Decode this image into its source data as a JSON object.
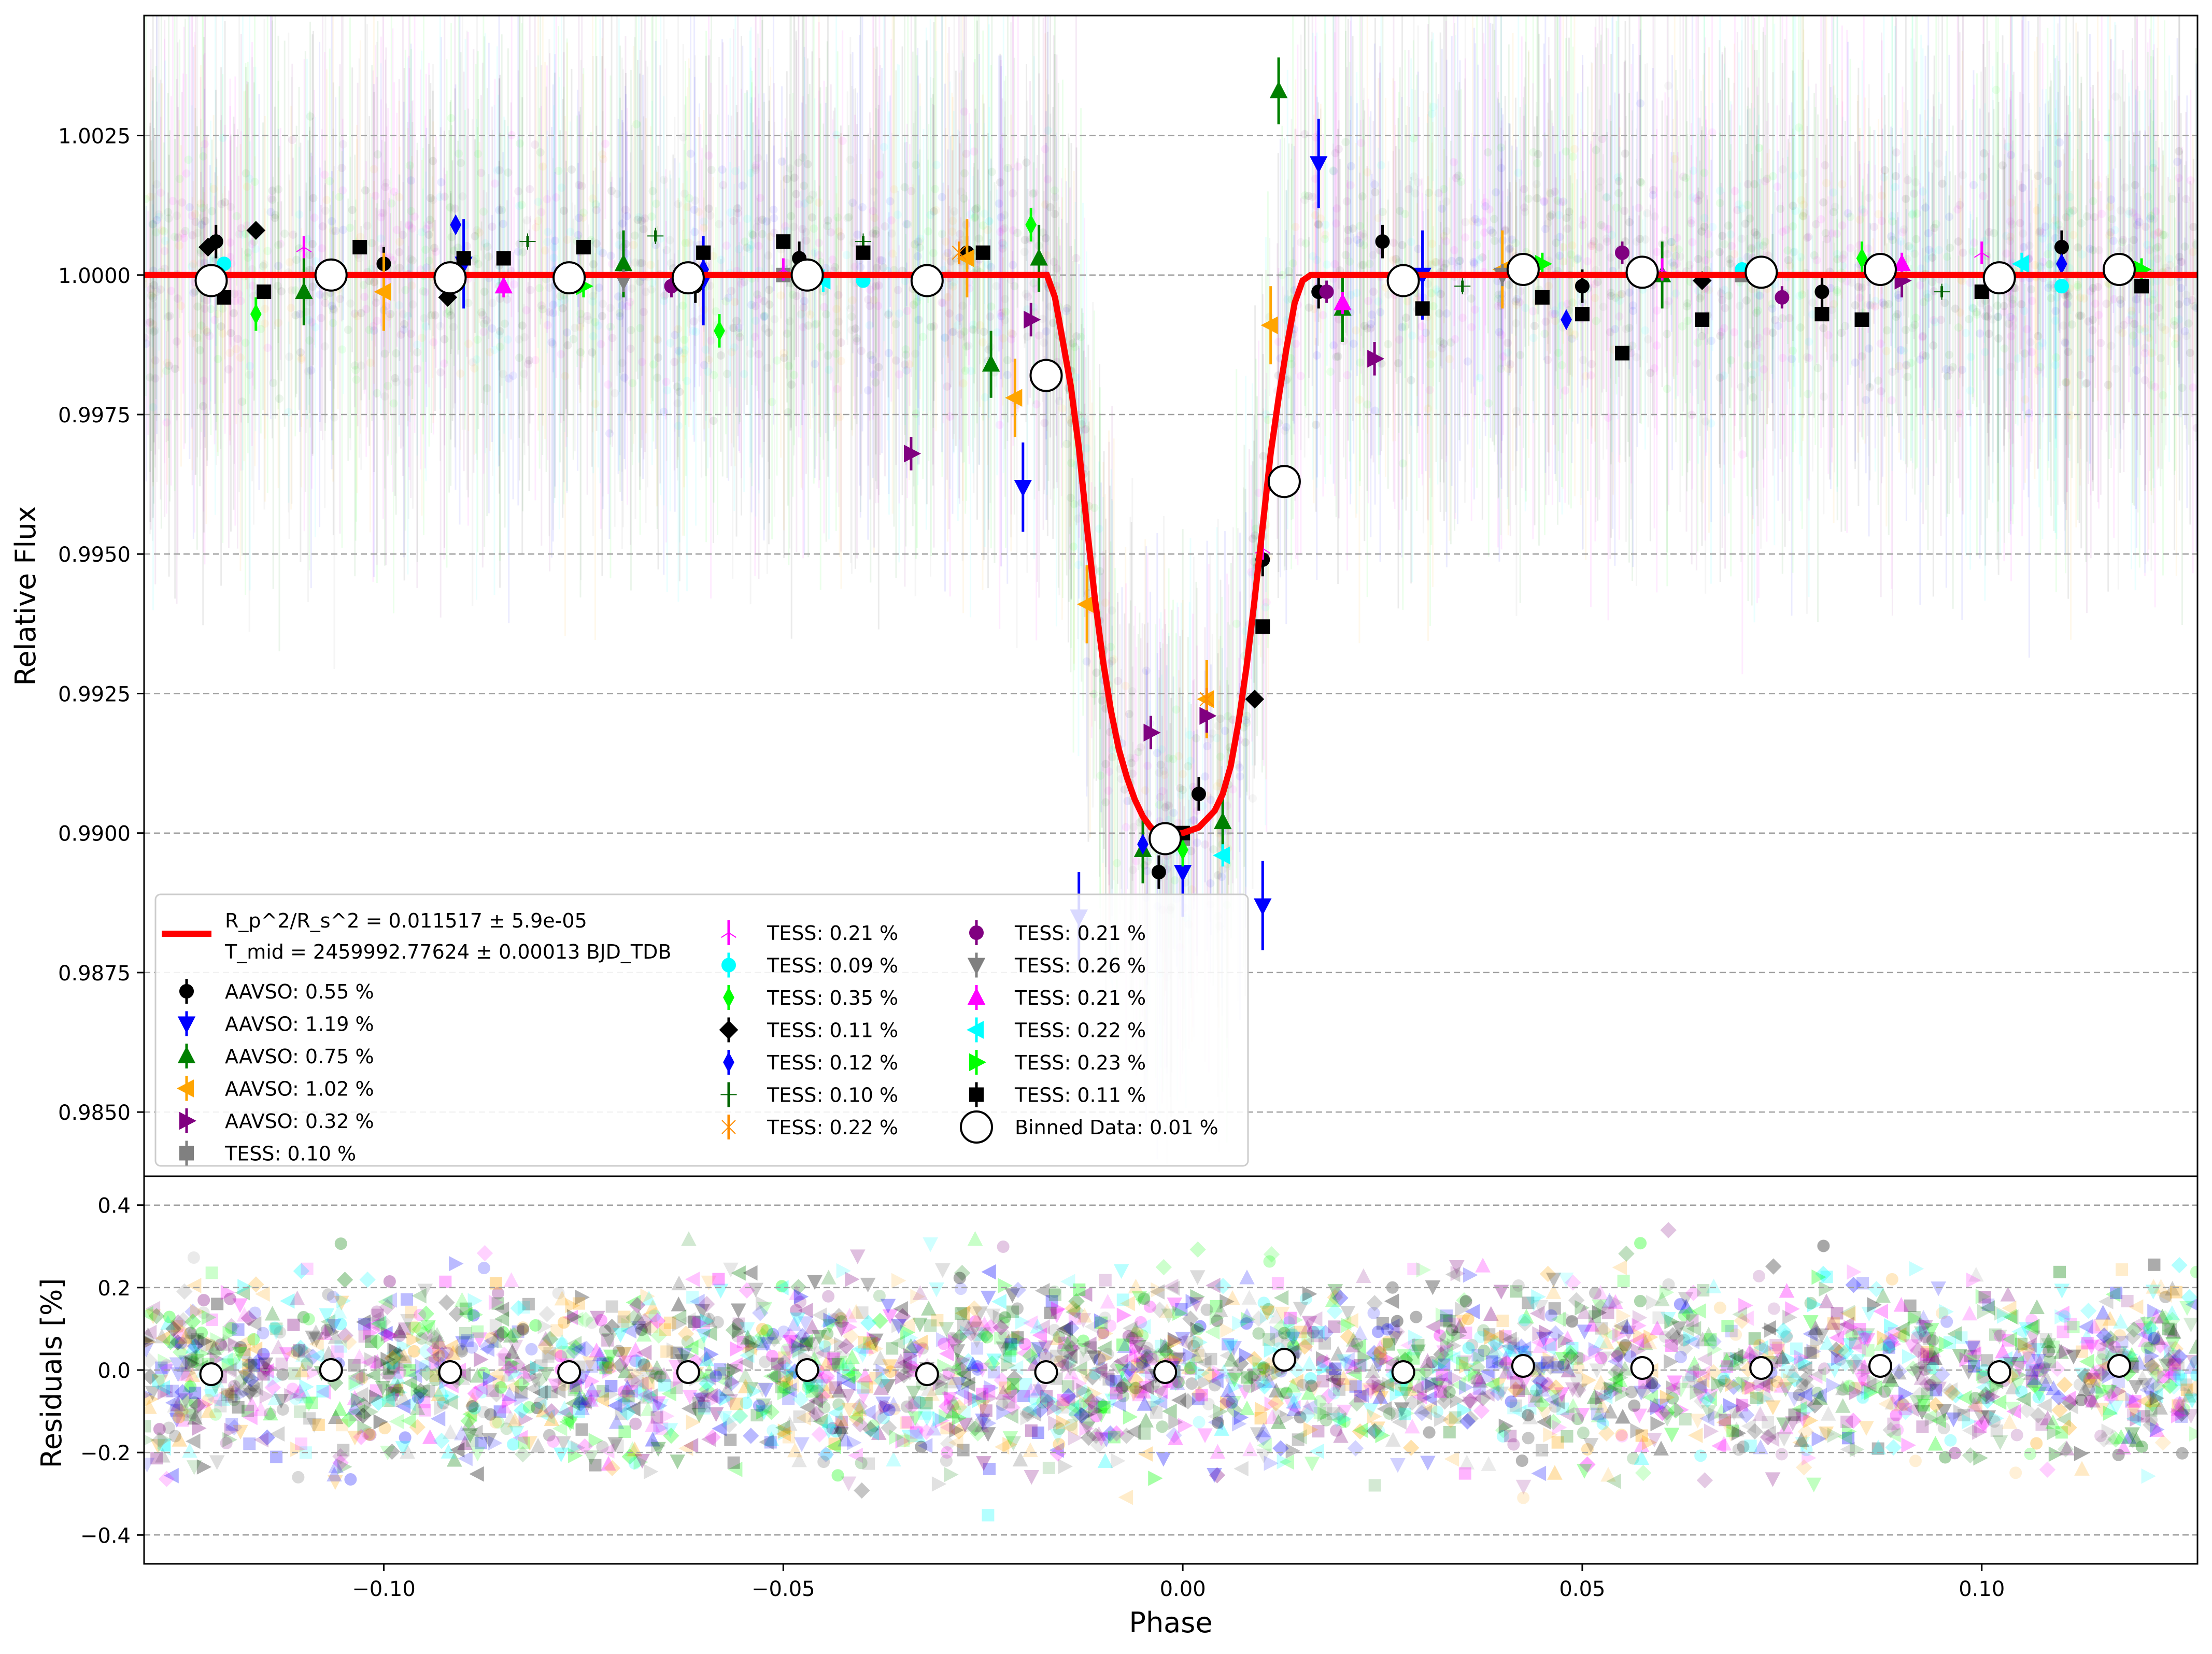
{
  "chart_data": [
    {
      "type": "scatter",
      "panel": "transit",
      "ylabel": "Relative Flux",
      "xlim": [
        -0.13,
        0.127
      ],
      "ylim": [
        0.98385,
        1.00465
      ],
      "yticks": [
        0.985,
        0.9875,
        0.99,
        0.9925,
        0.995,
        0.9975,
        1.0,
        1.0025
      ],
      "ytick_labels": [
        "0.9850",
        "0.9875",
        "0.9900",
        "0.9925",
        "0.9950",
        "0.9975",
        "1.0000",
        "1.0025"
      ],
      "grid": "horizontal dashed",
      "legend_position": "lower-left",
      "model": {
        "name": "R_p^2/R_s^2 = 0.011517 ± 5.9e-05",
        "name_line2": "T_mid = 2459992.77624 ± 0.00013 BJD_TDB",
        "color": "#ff0000",
        "x": [
          -0.13,
          -0.02,
          -0.017,
          -0.016,
          -0.014,
          -0.013,
          -0.012,
          -0.011,
          -0.01,
          -0.009,
          -0.008,
          -0.007,
          -0.006,
          -0.005,
          -0.004,
          -0.003,
          -0.002,
          -0.001,
          0.0,
          0.002,
          0.004,
          0.005,
          0.006,
          0.007,
          0.008,
          0.009,
          0.01,
          0.011,
          0.012,
          0.013,
          0.014,
          0.015,
          0.016,
          0.017,
          0.02,
          0.127
        ],
        "y": [
          1.0,
          1.0,
          1.0,
          0.9996,
          0.998,
          0.9969,
          0.9955,
          0.9942,
          0.9931,
          0.9922,
          0.9915,
          0.991,
          0.9906,
          0.9903,
          0.9901,
          0.99,
          0.99,
          0.99,
          0.99,
          0.9901,
          0.9904,
          0.9907,
          0.9912,
          0.992,
          0.993,
          0.9942,
          0.9955,
          0.9968,
          0.9978,
          0.9987,
          0.9995,
          0.9999,
          1.0,
          1.0,
          1.0,
          1.0
        ]
      },
      "binned": {
        "name": "Binned Data: 0.01 %",
        "x": [
          -0.1216,
          -0.1066,
          -0.0917,
          -0.0768,
          -0.0619,
          -0.047,
          -0.032,
          -0.0171,
          -0.0022,
          0.0127,
          0.0276,
          0.0426,
          0.0575,
          0.0724,
          0.0873,
          0.1022,
          0.1172
        ],
        "y": [
          0.9999,
          1.0,
          0.99995,
          0.99995,
          0.99995,
          1.0,
          0.9999,
          0.9982,
          0.9899,
          0.9963,
          0.9999,
          1.0001,
          1.00005,
          1.00005,
          1.0001,
          0.99995,
          1.0001
        ]
      },
      "series": [
        {
          "name": "AAVSO: 0.55 %",
          "color": "#000000",
          "marker": "circle",
          "x": [
            -0.121,
            -0.1,
            -0.061,
            -0.048,
            -0.027,
            -0.003,
            0.002,
            0.01,
            0.017,
            0.025,
            0.05,
            0.08,
            0.11
          ],
          "y": [
            1.0006,
            1.0002,
            0.9998,
            1.0003,
            1.0004,
            0.9893,
            0.9907,
            0.9949,
            0.9997,
            1.0006,
            0.9998,
            0.9997,
            1.0005
          ],
          "err": 0.0003
        },
        {
          "name": "AAVSO: 1.19 %",
          "color": "#0000ff",
          "marker": "triangle-down",
          "x": [
            -0.09,
            -0.06,
            -0.02,
            -0.013,
            0.0,
            0.01,
            0.017,
            0.03
          ],
          "y": [
            1.0002,
            0.9999,
            0.9962,
            0.9885,
            0.9893,
            0.9887,
            1.002,
            1.0
          ],
          "err": 0.0008
        },
        {
          "name": "AAVSO: 0.75 %",
          "color": "#008000",
          "marker": "triangle-up",
          "x": [
            -0.11,
            -0.07,
            -0.024,
            -0.018,
            -0.005,
            0.005,
            0.012,
            0.02,
            0.06
          ],
          "y": [
            0.9997,
            1.0002,
            0.9984,
            1.0003,
            0.9897,
            0.9902,
            1.0033,
            0.9994,
            1.0
          ],
          "err": 0.0006
        },
        {
          "name": "AAVSO: 1.02 %",
          "color": "#ffa500",
          "marker": "triangle-left",
          "x": [
            -0.1,
            -0.027,
            -0.021,
            -0.012,
            0.003,
            0.011,
            0.04
          ],
          "y": [
            0.9997,
            1.0003,
            0.9978,
            0.9941,
            0.9924,
            0.9991,
            1.0001
          ],
          "err": 0.0007
        },
        {
          "name": "AAVSO: 0.32 %",
          "color": "#800080",
          "marker": "triangle-right",
          "x": [
            -0.034,
            -0.019,
            -0.004,
            0.003,
            0.024,
            0.09
          ],
          "y": [
            0.9968,
            0.9992,
            0.9918,
            0.9921,
            0.9985,
            0.9999
          ],
          "err": 0.0003
        },
        {
          "name": "TESS: 0.10 %",
          "color": "#808080",
          "marker": "square",
          "x": [
            -0.05,
            0.0,
            0.07
          ],
          "y": [
            1.0,
            0.9899,
            1.0
          ],
          "err": 0.0001
        },
        {
          "name": "TESS: 0.21 %",
          "color": "#ff00ff",
          "marker": "tri",
          "x": [
            -0.11,
            -0.05,
            0.01,
            0.06,
            0.1
          ],
          "y": [
            1.0005,
            1.0001,
            0.9951,
            1.0001,
            1.0004
          ],
          "err": 0.0002
        },
        {
          "name": "TESS: 0.09 %",
          "color": "#00ffff",
          "marker": "circle",
          "x": [
            -0.12,
            -0.04,
            0.07,
            0.11
          ],
          "y": [
            1.0002,
            0.9999,
            1.0001,
            0.9998
          ],
          "err": 0.0001
        },
        {
          "name": "TESS: 0.35 %",
          "color": "#00ff00",
          "marker": "diamond-thin",
          "x": [
            -0.116,
            -0.058,
            -0.019,
            0.0,
            0.085
          ],
          "y": [
            0.9993,
            0.999,
            1.0009,
            0.9897,
            1.0003
          ],
          "err": 0.0003
        },
        {
          "name": "TESS: 0.11 %",
          "color": "#000000",
          "marker": "diamond",
          "x": [
            -0.122,
            -0.116,
            -0.092,
            0.009,
            0.065
          ],
          "y": [
            1.0005,
            1.0008,
            0.9996,
            0.9924,
            0.9999
          ],
          "err": 0.0001
        },
        {
          "name": "TESS: 0.12 %",
          "color": "#0000ff",
          "marker": "diamond-thin",
          "x": [
            -0.091,
            -0.06,
            -0.005,
            0.048,
            0.11
          ],
          "y": [
            1.0009,
            1.0001,
            0.9898,
            0.9992,
            1.0002
          ],
          "err": 0.0001
        },
        {
          "name": "TESS: 0.10 %",
          "color": "#006400",
          "marker": "plus",
          "x": [
            -0.082,
            -0.066,
            -0.04,
            0.035,
            0.095
          ],
          "y": [
            1.0006,
            1.0007,
            1.0006,
            0.9998,
            0.9997
          ],
          "err": 0.0001
        },
        {
          "name": "TESS: 0.22 %",
          "color": "#ff8c00",
          "marker": "x",
          "x": [
            -0.028,
            0.003
          ],
          "y": [
            1.0004,
            0.9924
          ],
          "err": 0.0002
        },
        {
          "name": "TESS: 0.21 %",
          "color": "#800080",
          "marker": "circle",
          "x": [
            -0.064,
            0.018,
            0.055,
            0.075
          ],
          "y": [
            0.9998,
            0.9997,
            1.0004,
            0.9996
          ],
          "err": 0.0002
        },
        {
          "name": "TESS: 0.26 %",
          "color": "#808080",
          "marker": "triangle-down",
          "x": [
            -0.07,
            0.04
          ],
          "y": [
            0.9999,
            1.0
          ],
          "err": 0.0002
        },
        {
          "name": "TESS: 0.21 %",
          "color": "#ff00ff",
          "marker": "triangle-up",
          "x": [
            -0.085,
            0.02,
            0.09
          ],
          "y": [
            0.9998,
            0.9995,
            1.0002
          ],
          "err": 0.0002
        },
        {
          "name": "TESS: 0.22 %",
          "color": "#00ffff",
          "marker": "triangle-left",
          "x": [
            -0.045,
            0.005,
            0.105
          ],
          "y": [
            0.9999,
            0.9896,
            1.0002
          ],
          "err": 0.0002
        },
        {
          "name": "TESS: 0.23 %",
          "color": "#00ff00",
          "marker": "triangle-right",
          "x": [
            -0.075,
            0.045,
            0.12
          ],
          "y": [
            0.9998,
            1.0002,
            1.0001
          ],
          "err": 0.0002
        },
        {
          "name": "TESS: 0.11 %",
          "color": "#000000",
          "marker": "square",
          "x": [
            -0.12,
            -0.115,
            -0.103,
            -0.09,
            -0.085,
            -0.075,
            -0.06,
            -0.05,
            -0.04,
            -0.025,
            0.0,
            0.01,
            0.03,
            0.045,
            0.05,
            0.055,
            0.065,
            0.08,
            0.085,
            0.1,
            0.12
          ],
          "y": [
            0.9996,
            0.9997,
            1.0005,
            1.0003,
            1.0003,
            1.0005,
            1.0004,
            1.0006,
            1.0004,
            1.0004,
            0.99,
            0.9937,
            0.9994,
            0.9996,
            0.9993,
            0.9986,
            0.9992,
            0.9993,
            0.9992,
            0.9997,
            0.9998
          ],
          "err": 0.0001
        }
      ]
    },
    {
      "type": "scatter",
      "panel": "residuals",
      "xlabel": "Phase",
      "ylabel": "Residuals [%]",
      "xlim": [
        -0.13,
        0.127
      ],
      "ylim": [
        -0.47,
        0.47
      ],
      "xticks": [
        -0.1,
        -0.05,
        0.0,
        0.05,
        0.1
      ],
      "xtick_labels": [
        "−0.10",
        "−0.05",
        "0.00",
        "0.05",
        "0.10"
      ],
      "yticks": [
        -0.4,
        -0.2,
        0.0,
        0.2,
        0.4
      ],
      "ytick_labels": [
        "−0.4",
        "−0.2",
        "0.0",
        "0.2",
        "0.4"
      ],
      "grid": "horizontal dashed",
      "binned": {
        "x": [
          -0.1216,
          -0.1066,
          -0.0917,
          -0.0768,
          -0.0619,
          -0.047,
          -0.032,
          -0.0171,
          -0.0022,
          0.0127,
          0.0276,
          0.0426,
          0.0575,
          0.0724,
          0.0873,
          0.1022,
          0.1172
        ],
        "y": [
          -0.01,
          0.0,
          -0.005,
          -0.005,
          -0.005,
          0.0,
          -0.01,
          -0.005,
          -0.005,
          0.025,
          -0.005,
          0.01,
          0.005,
          0.005,
          0.01,
          -0.005,
          0.01
        ]
      }
    }
  ]
}
